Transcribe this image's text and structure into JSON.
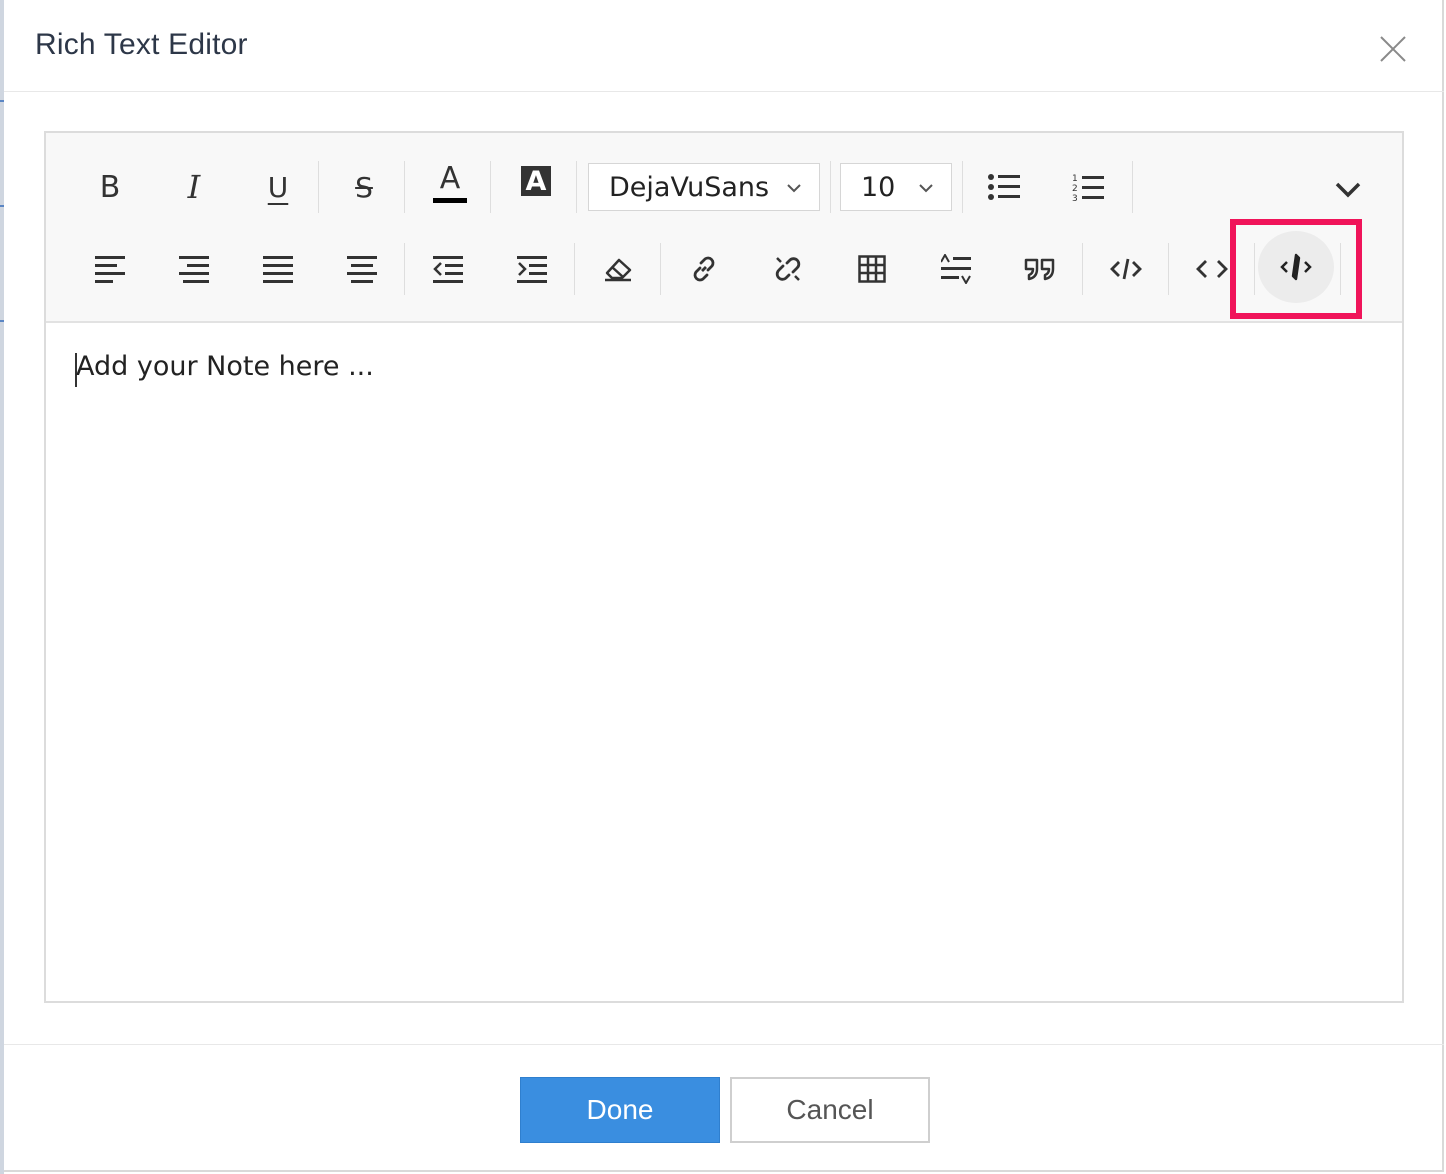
{
  "dialog": {
    "title": "Rich Text Editor",
    "close_icon": "close-icon"
  },
  "toolbar": {
    "row1": {
      "bold_label": "B",
      "italic_label": "I",
      "underline_label": "U",
      "strike_label": "S",
      "font_color_label": "A",
      "bg_color_label": "A",
      "font_family": "DejaVuSans",
      "font_size": "10",
      "icons": [
        "bold-icon",
        "italic-icon",
        "underline-icon",
        "strikethrough-icon",
        "font-color-icon",
        "background-color-icon",
        "bulleted-list-icon",
        "numbered-list-icon",
        "chevron-down-icon"
      ]
    },
    "row2": {
      "icons": [
        "align-left-icon",
        "align-right-icon",
        "justify-icon",
        "align-center-icon",
        "outdent-icon",
        "indent-icon",
        "eraser-icon",
        "link-icon",
        "unlink-icon",
        "table-icon",
        "line-height-icon",
        "blockquote-icon",
        "code-icon",
        "source-code-icon",
        "inline-code-icon"
      ]
    },
    "colors": {
      "font_color_bar": "#000000",
      "highlight_border": "#f0145a"
    }
  },
  "editor": {
    "placeholder": "Add your Note here ..."
  },
  "footer": {
    "done_label": "Done",
    "cancel_label": "Cancel",
    "done_color": "#3a8ee0"
  }
}
